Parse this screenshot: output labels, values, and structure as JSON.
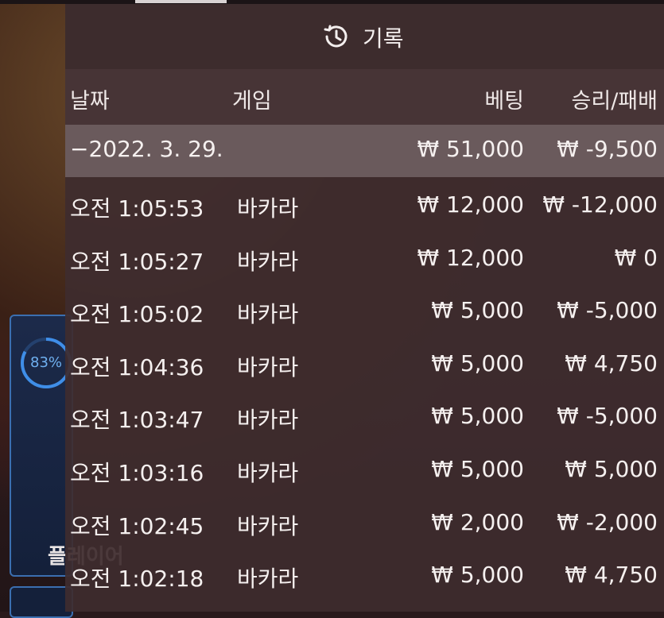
{
  "side": {
    "progress_label": "83%",
    "player_label": "플레이어"
  },
  "header": {
    "title": "기록",
    "icon": "history-icon"
  },
  "columns": {
    "date": "날짜",
    "game": "게임",
    "bet": "베팅",
    "win_loss": "승리/패배"
  },
  "summary": {
    "date": "−2022. 3. 29.",
    "bet": "₩ 51,000",
    "win_loss": "₩ -9,500"
  },
  "rows": [
    {
      "time": "오전 1:05:53",
      "game": "바카라",
      "bet": "₩ 12,000",
      "win_loss": "₩ -12,000"
    },
    {
      "time": "오전 1:05:27",
      "game": "바카라",
      "bet": "₩ 12,000",
      "win_loss": "₩ 0"
    },
    {
      "time": "오전 1:05:02",
      "game": "바카라",
      "bet": "₩ 5,000",
      "win_loss": "₩ -5,000"
    },
    {
      "time": "오전 1:04:36",
      "game": "바카라",
      "bet": "₩ 5,000",
      "win_loss": "₩ 4,750"
    },
    {
      "time": "오전 1:03:47",
      "game": "바카라",
      "bet": "₩ 5,000",
      "win_loss": "₩ -5,000"
    },
    {
      "time": "오전 1:03:16",
      "game": "바카라",
      "bet": "₩ 5,000",
      "win_loss": "₩ 5,000"
    },
    {
      "time": "오전 1:02:45",
      "game": "바카라",
      "bet": "₩ 2,000",
      "win_loss": "₩ -2,000"
    },
    {
      "time": "오전 1:02:18",
      "game": "바카라",
      "bet": "₩ 5,000",
      "win_loss": "₩ 4,750"
    }
  ]
}
